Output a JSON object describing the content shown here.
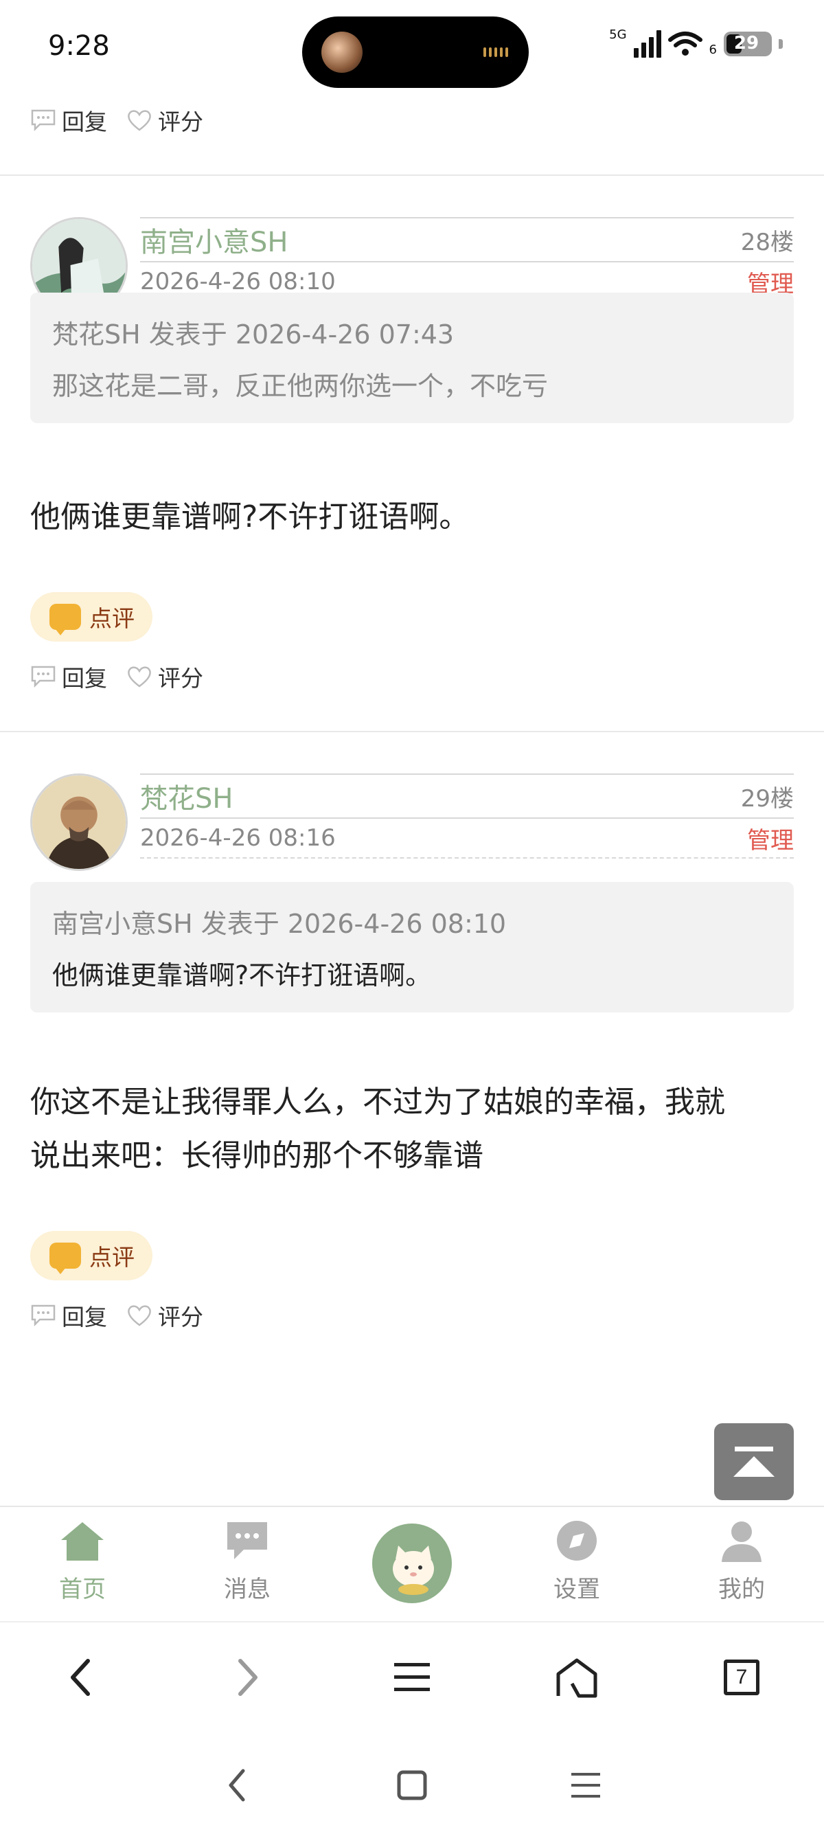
{
  "status_bar": {
    "time": "9:28",
    "network": "5G",
    "wifi_sub": "6",
    "battery": "29"
  },
  "top_actions": {
    "reply": "回复",
    "rate": "评分"
  },
  "posts": [
    {
      "username": "南宫小意SH",
      "floor": "28楼",
      "time": "2026-4-26 08:10",
      "manage": "管理",
      "quote_head": "梵花SH 发表于 2026-4-26 07:43",
      "quote_body": "那这花是二哥，反正他两你选一个，不吃亏",
      "body": "他俩谁更靠谱啊?不许打诳语啊。",
      "review": "点评",
      "reply": "回复",
      "rate": "评分"
    },
    {
      "username": "梵花SH",
      "floor": "29楼",
      "time": "2026-4-26 08:16",
      "manage": "管理",
      "quote_head": "南宫小意SH 发表于 2026-4-26 08:10",
      "quote_body": "他俩谁更靠谱啊?不许打诳语啊。",
      "body_line1": "你这不是让我得罪人么，不过为了姑娘的幸福，我就",
      "body_line2": "说出来吧：长得帅的那个不够靠谱",
      "review": "点评",
      "reply": "回复",
      "rate": "评分"
    }
  ],
  "tabbar": {
    "home": "首页",
    "messages": "消息",
    "settings": "设置",
    "mine": "我的"
  },
  "browser": {
    "tab_count": "7"
  },
  "colors": {
    "accent_green": "#8fb08a",
    "manage_red": "#e05a50",
    "review_bg": "#fdf1d6",
    "review_icon": "#f2b233"
  }
}
